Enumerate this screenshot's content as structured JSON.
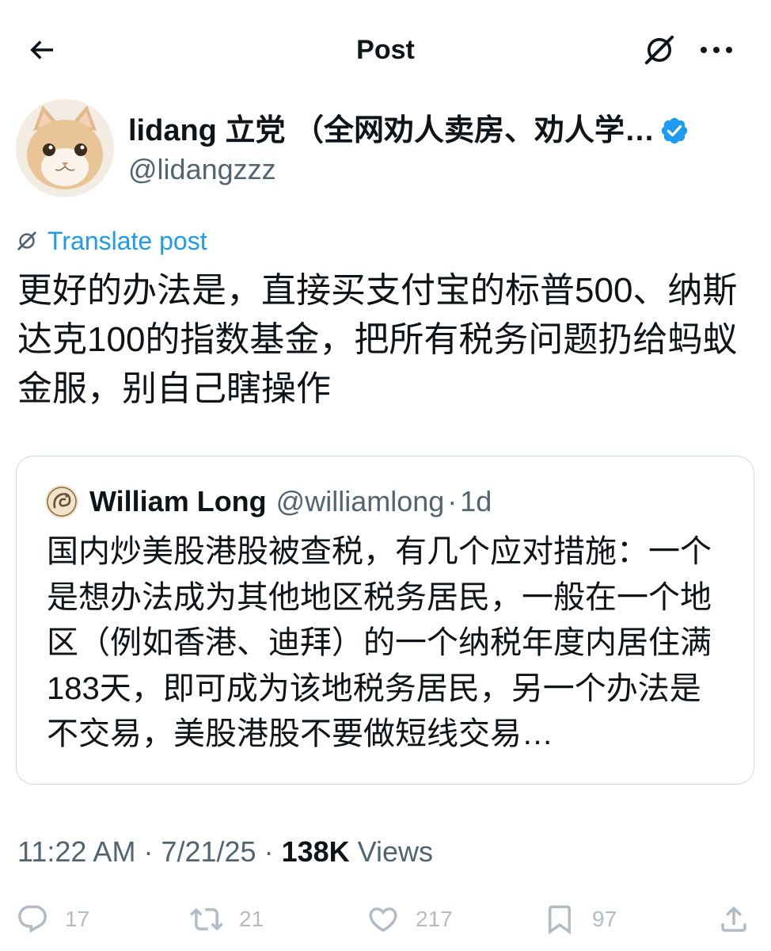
{
  "header": {
    "title": "Post",
    "back_icon": "arrow-left-icon",
    "grok_icon": "grok-icon",
    "more_icon": "more-horizontal-icon"
  },
  "author": {
    "display_name": "lidang 立党 （全网劝人卖房、劝人学…",
    "handle": "@lidangzzz",
    "verified": true,
    "avatar_icon": "cat-avatar"
  },
  "translate": {
    "label": "Translate post",
    "icon": "grok-icon"
  },
  "post": {
    "text": "更好的办法是，直接买支付宝的标普500、纳斯达克100的指数基金，把所有税务问题扔给蚂蚁金服，别自己瞎操作"
  },
  "quote": {
    "name": "William Long",
    "handle": "@williamlong",
    "separator": "·",
    "time": "1d",
    "avatar_icon": "dragon-logo",
    "text": "国内炒美股港股被查税，有几个应对措施：一个是想办法成为其他地区税务居民，一般在一个地区（例如香港、迪拜）的一个纳税年度内居住满183天，即可成为该地税务居民，另一个办法是不交易，美股港股不要做短线交易…"
  },
  "meta": {
    "time": "11:22 AM",
    "sep1": " · ",
    "date": "7/21/25",
    "sep2": " · ",
    "views_count": "138K",
    "views_label": " Views"
  },
  "actions": [
    {
      "icon": "reply-icon",
      "count": "17"
    },
    {
      "icon": "retweet-icon",
      "count": "21"
    },
    {
      "icon": "heart-icon",
      "count": "217"
    },
    {
      "icon": "bookmark-icon",
      "count": "97"
    },
    {
      "icon": "share-icon",
      "count": ""
    }
  ],
  "colors": {
    "text": "#0f1419",
    "secondary": "#536471",
    "accent": "#1d9bf0",
    "border": "#cfd9de",
    "action_muted": "#b3bcc4"
  }
}
